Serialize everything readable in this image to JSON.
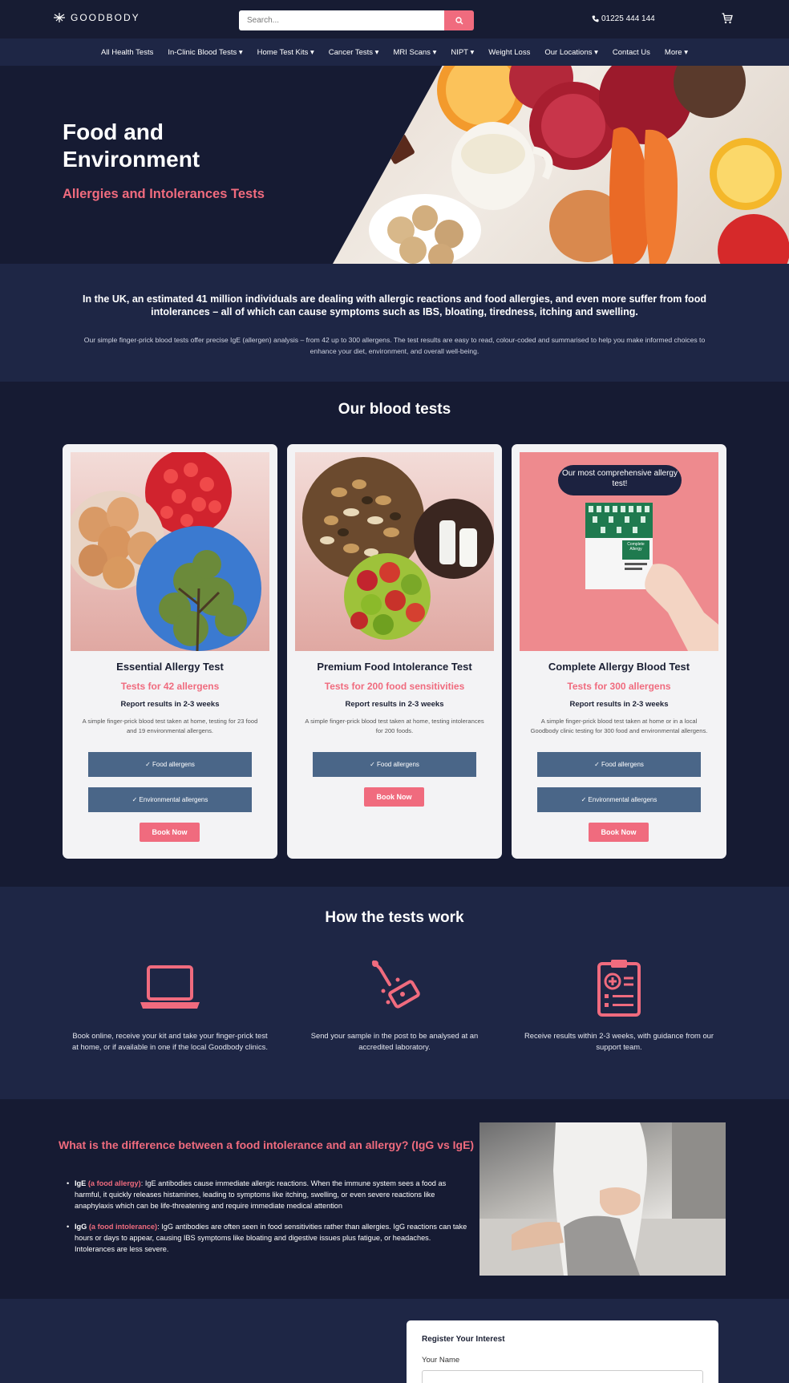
{
  "header": {
    "logo_text": "GOODBODY",
    "search_placeholder": "Search...",
    "phone": "01225 444 144"
  },
  "nav": {
    "items": [
      {
        "label": "All Health Tests"
      },
      {
        "label": "In-Clinic Blood Tests ▾"
      },
      {
        "label": "Home Test Kits ▾"
      },
      {
        "label": "Cancer Tests ▾"
      },
      {
        "label": "MRI Scans ▾"
      },
      {
        "label": "NIPT ▾"
      },
      {
        "label": "Weight Loss"
      },
      {
        "label": "Our Locations ▾"
      },
      {
        "label": "Contact Us"
      },
      {
        "label": "More ▾"
      }
    ]
  },
  "hero": {
    "title": "Food and Environment",
    "subtitle": "Allergies and Intolerances Tests"
  },
  "intro": {
    "lead": "In the UK, an estimated 41 million individuals are dealing with allergic reactions and food allergies, and even more suffer from food intolerances – all of which can cause symptoms such as IBS, bloating, tiredness, itching and swelling.",
    "body": "Our simple finger-prick blood tests offer precise IgE (allergen) analysis – from 42 up to 300 allergens. The test results are easy to read, colour-coded and summarised to help you make informed choices to enhance your diet, environment, and overall well-being."
  },
  "tests": {
    "title": "Our blood tests",
    "cards": [
      {
        "title": "Essential Allergy Test",
        "subtitle": "Tests for 42 allergens",
        "report": "Report results in 2-3 weeks",
        "desc": "A simple finger-prick blood test taken at home, testing for 23 food and 19 environmental allergens.",
        "pill1": "✓ Food allergens",
        "pill2": "✓ Environmental allergens",
        "book": "Book Now"
      },
      {
        "title": "Premium Food Intolerance Test",
        "subtitle": "Tests for 200 food sensitivities",
        "report": "Report results in 2-3 weeks",
        "desc": "A simple finger-prick blood test taken at home, testing intolerances for 200 foods.",
        "pill1": "✓ Food allergens",
        "book": "Book Now"
      },
      {
        "title": "Complete Allergy Blood Test",
        "subtitle": "Tests for 300 allergens",
        "report": "Report results in 2-3 weeks",
        "desc": "A simple finger-prick blood test taken at home or in a local Goodbody clinic testing for 300 food and environmental allergens.",
        "pill1": "✓ Food allergens",
        "pill2": "✓ Environmental allergens",
        "book": "Book Now",
        "badge": "Our most comprehensive allergy test!",
        "box_label": "Complete Allergy"
      }
    ]
  },
  "how": {
    "title": "How the tests work",
    "steps": [
      {
        "text": "Book online, receive your kit and take your finger-prick test at home, or if available in one if the local Goodbody clinics."
      },
      {
        "text": "Send your sample in the post to be analysed at an accredited laboratory."
      },
      {
        "text": "Receive results within 2-3 weeks, with guidance from our support team."
      }
    ]
  },
  "difference": {
    "title": "What is the difference between a food intolerance and an allergy? (IgG vs IgE)",
    "items": [
      {
        "term": "IgE",
        "tag": "(a food allergy)",
        "text": ": IgE antibodies cause immediate allergic reactions. When the immune system sees a food as harmful, it quickly releases histamines, leading to symptoms like itching, swelling, or even severe reactions like anaphylaxis which can be life-threatening and require immediate medical attention"
      },
      {
        "term": "IgG",
        "tag": "(a food intolerance)",
        "text": ": IgG antibodies are often seen in food sensitivities rather than allergies. IgG reactions can take hours or days to appear, causing IBS symptoms like bloating and digestive issues plus fatigue, or headaches. Intolerances are less severe."
      }
    ]
  },
  "register": {
    "title": "Register Your Interest",
    "name_label": "Your Name"
  },
  "colors": {
    "accent": "#f06b7e",
    "navy": "#161b33",
    "navy_light": "#1e2645",
    "pill": "#4a6688"
  }
}
